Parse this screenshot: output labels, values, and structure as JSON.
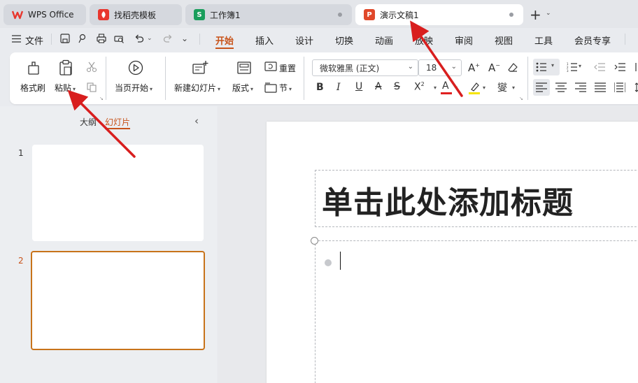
{
  "tabs": [
    {
      "label": "WPS Office",
      "icon": "wps-logo-icon",
      "color": "#e8362d"
    },
    {
      "label": "找稻壳模板",
      "icon": "docer-icon",
      "color": "#e8362d"
    },
    {
      "label": "工作簿1",
      "icon": "spreadsheet-icon",
      "icon_text": "S",
      "color": "#1a9e5c"
    },
    {
      "label": "演示文稿1",
      "icon": "presentation-icon",
      "icon_text": "P",
      "color": "#e0482a",
      "active": true
    }
  ],
  "new_tab": "+",
  "menu": {
    "file": "文件",
    "items": [
      "开始",
      "插入",
      "设计",
      "切换",
      "动画",
      "放映",
      "审阅",
      "视图",
      "工具",
      "会员专享"
    ]
  },
  "ribbon": {
    "format_painter": "格式刷",
    "paste": "粘贴",
    "start_from_first": "当页开始",
    "new_slide": "新建幻灯片",
    "layout": "版式",
    "reset": "重置",
    "section": "节",
    "font_name": "微软雅黑 (正文)",
    "font_size": "18"
  },
  "panel": {
    "tab_outline": "大纲",
    "tab_slides": "幻灯片",
    "slides": [
      {
        "num": "1"
      },
      {
        "num": "2",
        "selected": true
      }
    ]
  },
  "slide": {
    "title_placeholder": "单击此处添加标题"
  },
  "colors": {
    "accent": "#c8531a",
    "font_color_bar": "#e02020",
    "highlight_bar": "#f5e400"
  }
}
